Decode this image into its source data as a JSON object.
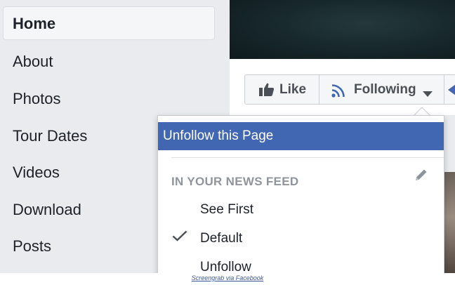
{
  "sidebar": {
    "items": [
      {
        "label": "Home",
        "active": true
      },
      {
        "label": "About"
      },
      {
        "label": "Photos"
      },
      {
        "label": "Tour Dates"
      },
      {
        "label": "Videos"
      },
      {
        "label": "Download"
      },
      {
        "label": "Posts"
      }
    ]
  },
  "actions": {
    "like_label": "Like",
    "following_label": "Following"
  },
  "dropdown": {
    "unfollow_page": "Unfollow this Page",
    "section_title": "IN YOUR NEWS FEED",
    "options": [
      {
        "label": "See First",
        "selected": false
      },
      {
        "label": "Default",
        "selected": true
      },
      {
        "label": "Unfollow",
        "selected": false
      }
    ]
  },
  "caption": "Screengrab via Facebook",
  "colors": {
    "accent": "#4267b2",
    "rss_icon": "#4267b2",
    "sidebar_bg": "#e9ebee"
  },
  "icons": [
    "thumbs-up-icon",
    "rss-icon",
    "caret-down-icon",
    "share-icon",
    "pencil-icon",
    "checkmark-icon"
  ]
}
